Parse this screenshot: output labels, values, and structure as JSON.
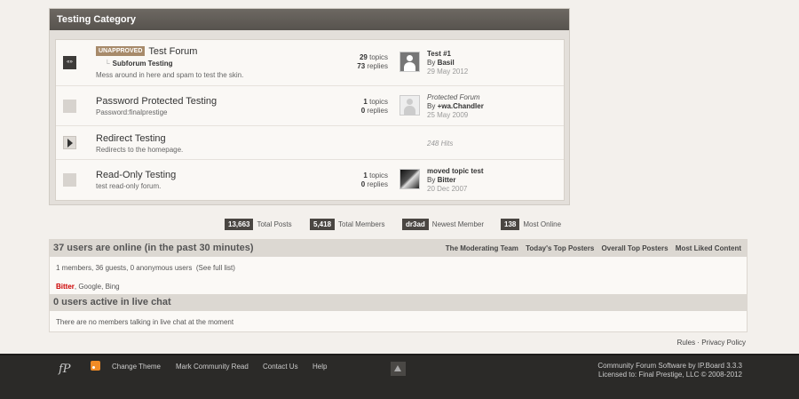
{
  "category": {
    "title": "Testing Category",
    "forums": [
      {
        "badge": "UNAPPROVED",
        "name": "Test Forum",
        "subforum": "Subforum Testing",
        "description": "Mess around in here and spam to test the skin.",
        "topics": "29",
        "topics_label": "topics",
        "replies": "73",
        "replies_label": "replies",
        "last_post": {
          "title": "Test #1",
          "by": "By",
          "author": "Basil",
          "date": "29 May 2012"
        }
      },
      {
        "name": "Password Protected Testing",
        "description": "Password:finalprestige",
        "topics": "1",
        "topics_label": "topics",
        "replies": "0",
        "replies_label": "replies",
        "last_post": {
          "title": "Protected Forum",
          "by": "By",
          "author": "+wa.Chandler",
          "date": "25 May 2009"
        }
      },
      {
        "name": "Redirect Testing",
        "description": "Redirects to the homepage.",
        "hits": "248 Hits"
      },
      {
        "name": "Read-Only Testing",
        "description": "test read-only forum.",
        "topics": "1",
        "topics_label": "topics",
        "replies": "0",
        "replies_label": "replies",
        "last_post": {
          "title": "moved topic test",
          "by": "By",
          "author": "Bitter",
          "date": "20 Dec 2007"
        }
      }
    ]
  },
  "stats": {
    "total_posts": "13,663",
    "total_posts_label": "Total Posts",
    "total_members": "5,418",
    "total_members_label": "Total Members",
    "newest_member": "dr3ad",
    "newest_member_label": "Newest Member",
    "most_online": "138",
    "most_online_label": "Most Online"
  },
  "online": {
    "header": "37 users are online (in the past 30 minutes)",
    "links": [
      "The Moderating Team",
      "Today's Top Posters",
      "Overall Top Posters",
      "Most Liked Content"
    ],
    "summary": "1 members, 36 guests, 0 anonymous users",
    "full_list": "(See full list)",
    "user_red": "Bitter",
    "users_rest": ", Google, Bing",
    "chat_header": "0 users active in live chat",
    "chat_text": "There are no members talking in live chat at the moment"
  },
  "rules_link": "Rules",
  "rules_sep": "·",
  "privacy_link": "Privacy Policy",
  "footer": {
    "logo": "fP",
    "links": [
      "Change Theme",
      "Mark Community Read",
      "Contact Us",
      "Help"
    ],
    "copy1": "Community Forum Software by IP.Board 3.3.3",
    "copy2": "Licensed to: Final Prestige, LLC © 2008-2012"
  },
  "icons": {
    "rss": "rss-icon",
    "up": "up-arrow-icon",
    "forum": "forum-icon",
    "redirect": "redirect-arrow-icon"
  },
  "colors": {
    "header": "#5f5a55",
    "accent_red": "#cc0000",
    "badge": "#a78a6a",
    "footer": "#2b2a28"
  }
}
